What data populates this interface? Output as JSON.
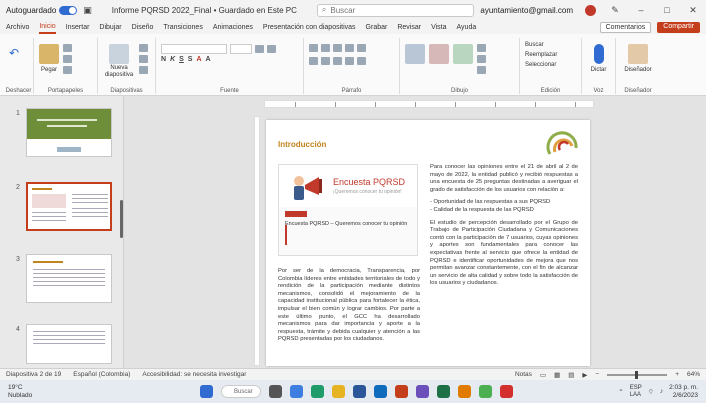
{
  "titlebar": {
    "autosave_label": "Autoguardado",
    "doc_title": "Informe PQRSD 2022_Final • Guardado en Este PC",
    "search_placeholder": "Buscar",
    "user": "ayuntamiento@gmail.com"
  },
  "tabs": [
    "Archivo",
    "Inicio",
    "Insertar",
    "Dibujar",
    "Diseño",
    "Transiciones",
    "Animaciones",
    "Presentación con diapositivas",
    "Grabar",
    "Revisar",
    "Vista",
    "Ayuda"
  ],
  "tabs_right": {
    "comment": "Comentarios",
    "share": "Compartir"
  },
  "ribbon": {
    "groups": [
      "Deshacer",
      "Portapapeles",
      "Diapositivas",
      "Fuente",
      "Párrafo",
      "Dibujo",
      "Edición",
      "Voz",
      "Diseñador"
    ],
    "paste": "Pegar",
    "new_slide": "Nueva diapositiva",
    "find": "Buscar",
    "replace": "Reemplazar",
    "select": "Seleccionar",
    "dictate": "Dictar",
    "designer": "Diseñador"
  },
  "thumbnails": {
    "numbers": [
      "1",
      "2",
      "3",
      "4"
    ]
  },
  "slide": {
    "title": "Introducción",
    "card_headline": "Encuesta PQRSD",
    "card_sub": "¡Queremos conocer tu opinión!",
    "card_caption": "Encuesta PQRSD – Queremos conocer tu opinión",
    "left_paragraph": "Por ser de la democracia, Transparencia, por Colombia líderes entre entidades territoriales de todo y rendición de la participación mediante distintos mecanismos, consolidó el mejoramiento de la capacidad institucional pública para fortalecer la ética, impulsar el bien común y lograr cambios. Por parte a este último punto, el GCC ha desarrollado mecanismos para dar importancia y aporte a la respuesta, trámite y debida cualquier y atención a las PQRSD presentadas por los ciudadanos.",
    "right_p1": "Para conocer las opiniones entre el 21 de abril al 2 de mayo de 2022, la entidad publicó y recibió respuestas a una encuesta de 25 preguntas destinadas a averiguar el grado de satisfacción de los usuarios con relación a:",
    "right_p2": "- Oportunidad de las respuestas a sus PQRSD\n- Calidad de la respuesta de las PQRSD",
    "right_p3": "El estudio de percepción desarrollado por el Grupo de Trabajo de Participación Ciudadana y Comunicaciones contó con la participación de 7 usuarios, cuyas opiniones y aportes son fundamentales para conocer las expectativas frente al servicio que ofrece la entidad de PQRSD e identificar oportunidades de mejora que nos permitan avanzar constantemente, con el fin de alcanzar un servicio de alta calidad y sobre todo la satisfacción de los usuarios y ciudadanos."
  },
  "statusbar": {
    "slide_info": "Diapositiva 2 de 19",
    "language": "Español (Colombia)",
    "accessibility": "Accesibilidad: se necesita investigar",
    "notes": "Notas",
    "zoom": "64%"
  },
  "taskbar": {
    "temp": "19°C",
    "weather": "Nublado",
    "search": "Buscar",
    "lang": "ESP",
    "lang2": "LAA",
    "time": "2:03 p. m.",
    "date": "2/6/2023"
  },
  "colors": {
    "accent": "#c43e1c",
    "slide_title": "#c0841c",
    "headline_red": "#c0392b",
    "thumb_green": "#6e8e3a"
  }
}
